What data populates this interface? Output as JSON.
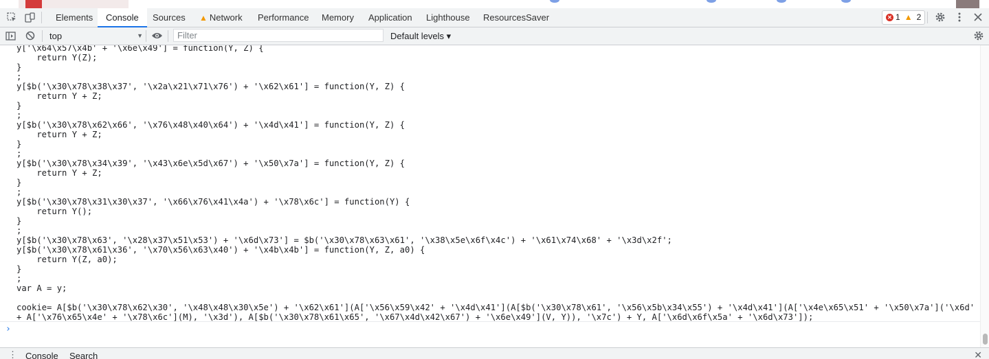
{
  "devtools": {
    "tabs": [
      {
        "label": "Elements"
      },
      {
        "label": "Console",
        "active": true
      },
      {
        "label": "Sources"
      },
      {
        "label": "Network",
        "warning": true
      },
      {
        "label": "Performance"
      },
      {
        "label": "Memory"
      },
      {
        "label": "Application"
      },
      {
        "label": "Lighthouse"
      },
      {
        "label": "ResourcesSaver"
      }
    ],
    "issues": {
      "errors": "1",
      "warnings": "2"
    },
    "accent_color": "#1a73e8"
  },
  "toolbar": {
    "context": "top",
    "filter_placeholder": "Filter",
    "levels_label": "Default levels ▾"
  },
  "console": {
    "lines": [
      "y['\\x64\\x57\\x4b' + '\\x6e\\x49'] = function(Y, Z) {",
      "    return Y(Z);",
      "}",
      ";",
      "y[$b('\\x30\\x78\\x38\\x37', '\\x2a\\x21\\x71\\x76') + '\\x62\\x61'] = function(Y, Z) {",
      "    return Y + Z;",
      "}",
      ";",
      "y[$b('\\x30\\x78\\x62\\x66', '\\x76\\x48\\x40\\x64') + '\\x4d\\x41'] = function(Y, Z) {",
      "    return Y + Z;",
      "}",
      ";",
      "y[$b('\\x30\\x78\\x34\\x39', '\\x43\\x6e\\x5d\\x67') + '\\x50\\x7a'] = function(Y, Z) {",
      "    return Y + Z;",
      "}",
      ";",
      "y[$b('\\x30\\x78\\x31\\x30\\x37', '\\x66\\x76\\x41\\x4a') + '\\x78\\x6c'] = function(Y) {",
      "    return Y();",
      "}",
      ";",
      "y[$b('\\x30\\x78\\x63', '\\x28\\x37\\x51\\x53') + '\\x6d\\x73'] = $b('\\x30\\x78\\x63\\x61', '\\x38\\x5e\\x6f\\x4c') + '\\x61\\x74\\x68' + '\\x3d\\x2f';",
      "y[$b('\\x30\\x78\\x61\\x36', '\\x70\\x56\\x63\\x40') + '\\x4b\\x4b'] = function(Y, Z, a0) {",
      "    return Y(Z, a0);",
      "}",
      ";",
      "var A = y;",
      "",
      "cookie= A[$b('\\x30\\x78\\x62\\x30', '\\x48\\x48\\x30\\x5e') + '\\x62\\x61'](A['\\x56\\x59\\x42' + '\\x4d\\x41'](A[$b('\\x30\\x78\\x61', '\\x56\\x5b\\x34\\x55') + '\\x4d\\x41'](A['\\x4e\\x65\\x51' + '\\x50\\x7a']('\\x6d'",
      "+ A['\\x76\\x65\\x4e' + '\\x78\\x6c'](M), '\\x3d'), A[$b('\\x30\\x78\\x61\\x65', '\\x67\\x4d\\x42\\x67') + '\\x6e\\x49'](V, Y)), '\\x7c') + Y, A['\\x6d\\x6f\\x5a' + '\\x6d\\x73']);"
    ],
    "prompt": "›"
  },
  "drawer": {
    "tabs": [
      "Console",
      "Search"
    ]
  }
}
